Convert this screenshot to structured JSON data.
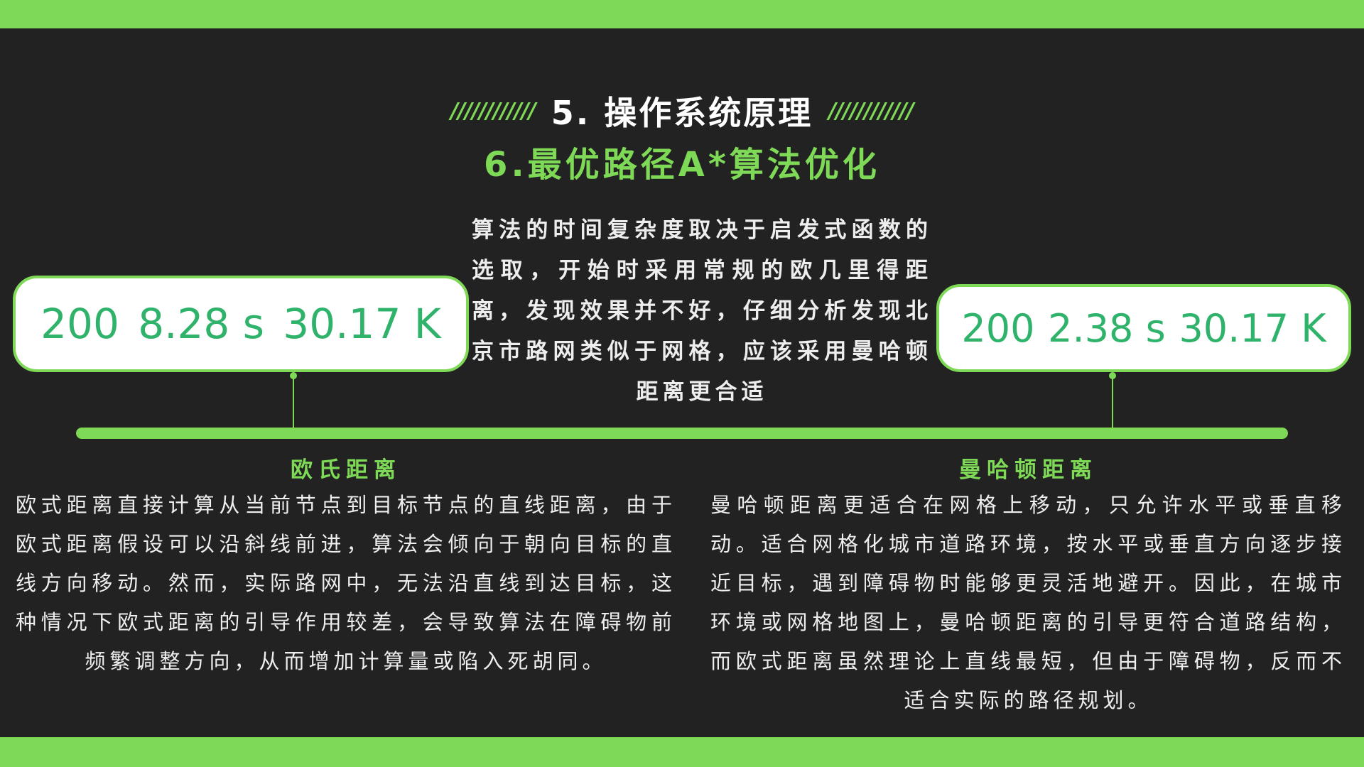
{
  "header": {
    "hatch_left": "////////////",
    "title": "5. 操作系统原理",
    "hatch_right": "////////////",
    "subtitle": "6.最优路径A*算法优化"
  },
  "description": "算法的时间复杂度取决于启发式函数的选取，开始时采用常规的欧几里得距离，发现效果并不好，仔细分析发现北京市路网类似于网格，应该采用曼哈顿距离更合适",
  "stats": {
    "left": {
      "count": "200",
      "time": "8.28 s",
      "memory": "30.17 K"
    },
    "right": {
      "count": "200",
      "time": "2.38 s",
      "memory": "30.17 K"
    }
  },
  "columns": {
    "left": {
      "title": "欧氏距离",
      "text": "欧式距离直接计算从当前节点到目标节点的直线距离，由于欧式距离假设可以沿斜线前进，算法会倾向于朝向目标的直线方向移动。然而，实际路网中，无法沿直线到达目标，这种情况下欧式距离的引导作用较差，会导致算法在障碍物前频繁调整方向，从而增加计算量或陷入死胡同。"
    },
    "right": {
      "title": "曼哈顿距离",
      "text": "曼哈顿距离更适合在网格上移动，只允许水平或垂直移动。适合网格化城市道路环境，按水平或垂直方向逐步接近目标，遇到障碍物时能够更灵活地避开。因此，在城市环境或网格地图上，曼哈顿距离的引导更符合道路结构，而欧式距离虽然理论上直线最短，但由于障碍物，反而不适合实际的路径规划。"
    }
  },
  "colors": {
    "accent": "#7ed957",
    "background": "#222222",
    "stat_text": "#2fb36b"
  }
}
